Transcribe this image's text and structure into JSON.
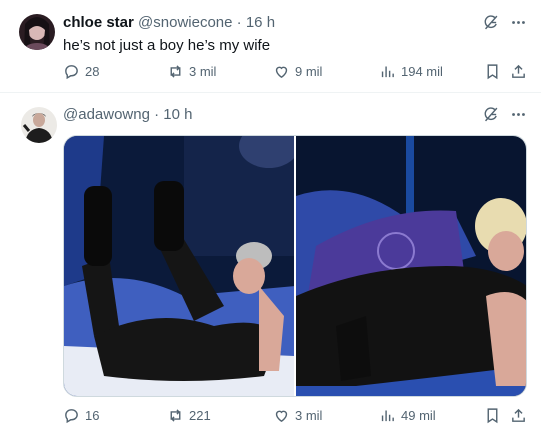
{
  "tweets": [
    {
      "name": "chloe star",
      "handle": "@snowiecone",
      "separator": "·",
      "time": "16 h",
      "text": "he’s not just a boy he’s my wife",
      "stats": {
        "replies": "28",
        "reposts": "3 mil",
        "likes": "9 mil",
        "views": "194 mil"
      }
    },
    {
      "name": "",
      "handle": "@adawowng",
      "separator": "·",
      "time": "10 h",
      "text": "",
      "stats": {
        "replies": "16",
        "reposts": "221",
        "likes": "3 mil",
        "views": "49 mil"
      }
    }
  ],
  "icons": {
    "grok": "grok-icon",
    "more": "more-icon",
    "reply": "reply-icon",
    "repost": "repost-icon",
    "like": "like-icon",
    "views": "views-icon",
    "bookmark": "bookmark-icon",
    "share": "share-icon"
  },
  "colors": {
    "text": "#0f1419",
    "secondary": "#536471",
    "border": "#eff3f4"
  }
}
